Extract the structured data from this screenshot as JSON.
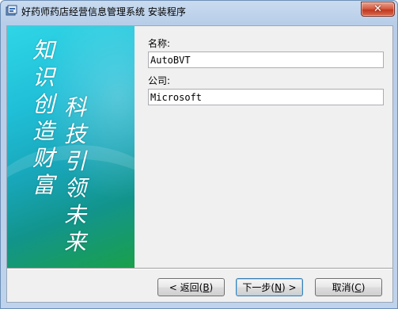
{
  "window": {
    "title": "好药师药店经营信息管理系统 安装程序",
    "close_label": "✕"
  },
  "banner": {
    "col1": [
      "知",
      "识",
      "创",
      "造",
      "财",
      "富"
    ],
    "col2": [
      "科",
      "技",
      "引",
      "领",
      "未",
      "来"
    ]
  },
  "form": {
    "name_label": "名称:",
    "name_value": "AutoBVT",
    "company_label": "公司:",
    "company_value": "Microsoft"
  },
  "buttons": {
    "back_pre": "< 返回(",
    "back_key": "B",
    "back_post": ")",
    "next_pre": "下一步(",
    "next_key": "N",
    "next_post": ") >",
    "cancel_pre": "取消(",
    "cancel_key": "C",
    "cancel_post": ")"
  },
  "colors": {
    "banner_top": "#2fd6e6",
    "banner_bottom": "#1aa04a",
    "close_button": "#c1381e"
  }
}
